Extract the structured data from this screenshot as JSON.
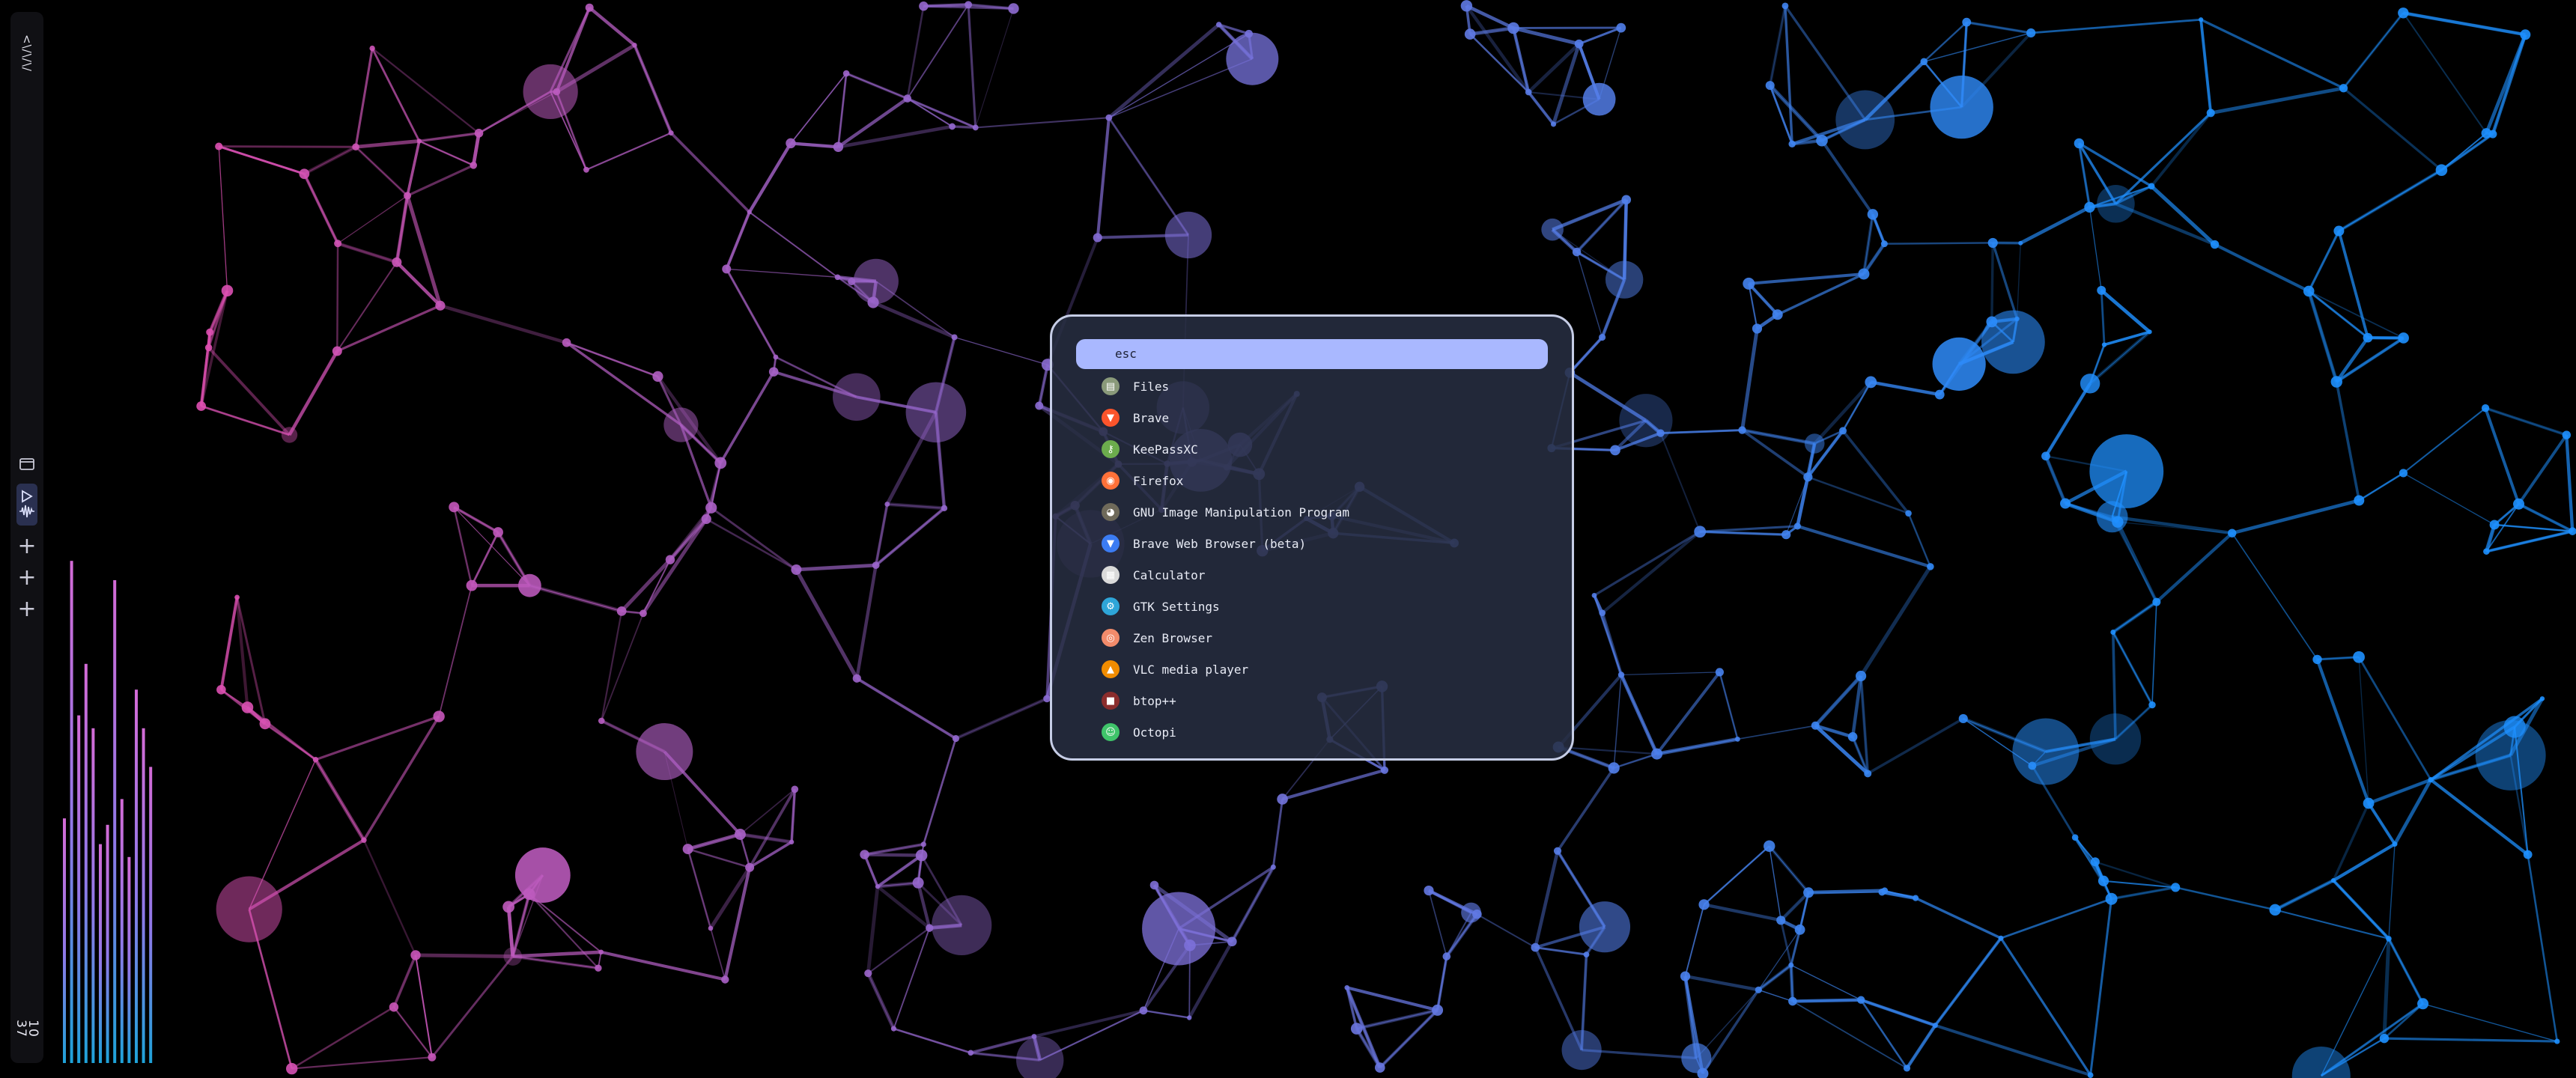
{
  "launcher": {
    "search": {
      "text": "esc"
    },
    "apps": [
      {
        "name": "Files",
        "icon": "file-manager-icon",
        "color": "#8a9a7a"
      },
      {
        "name": "Brave",
        "icon": "brave-lion-icon",
        "color": "#fb542b"
      },
      {
        "name": "KeePassXC",
        "icon": "keepassxc-key-icon",
        "color": "#6cac4d"
      },
      {
        "name": "Firefox",
        "icon": "firefox-icon",
        "color": "#ff7139"
      },
      {
        "name": "GNU Image Manipulation Program",
        "icon": "gimp-icon",
        "color": "#6f6a5a"
      },
      {
        "name": "Brave Web Browser (beta)",
        "icon": "brave-beta-icon",
        "color": "#3b7cf3"
      },
      {
        "name": "Calculator",
        "icon": "calculator-icon",
        "color": "#dadada"
      },
      {
        "name": "GTK Settings",
        "icon": "gtk-settings-icon",
        "color": "#2ea5d8"
      },
      {
        "name": "Zen Browser",
        "icon": "zen-browser-icon",
        "color": "#f28b6b"
      },
      {
        "name": "VLC media player",
        "icon": "vlc-cone-icon",
        "color": "#f08c00"
      },
      {
        "name": "btop++",
        "icon": "btop-icon",
        "color": "#8b2d2d"
      },
      {
        "name": "Octopi",
        "icon": "octopi-icon",
        "color": "#3fc46a"
      }
    ]
  },
  "sidebar": {
    "logo": "<\\/\\/\\/",
    "workspaces": [
      {
        "icon": "window-icon",
        "active": false
      },
      {
        "icon": "play-icon",
        "active": true
      },
      {
        "icon": "waveform-icon",
        "active": true
      },
      {
        "icon": "plus-icon",
        "active": false
      },
      {
        "icon": "plus-icon",
        "active": false
      },
      {
        "icon": "plus-icon",
        "active": false
      }
    ],
    "clock": {
      "hours": "10",
      "minutes": "37"
    }
  },
  "visualizer": {
    "levels": [
      0.38,
      0.78,
      0.54,
      0.62,
      0.52,
      0.34,
      0.37,
      0.75,
      0.41,
      0.32,
      0.58,
      0.52,
      0.46
    ]
  },
  "colors": {
    "accent": "#a9b8ff",
    "panel": "#282e42",
    "border": "#c6cde6",
    "wallpaper_pink": "#e04fb0",
    "wallpaper_blue": "#1e90ff"
  }
}
